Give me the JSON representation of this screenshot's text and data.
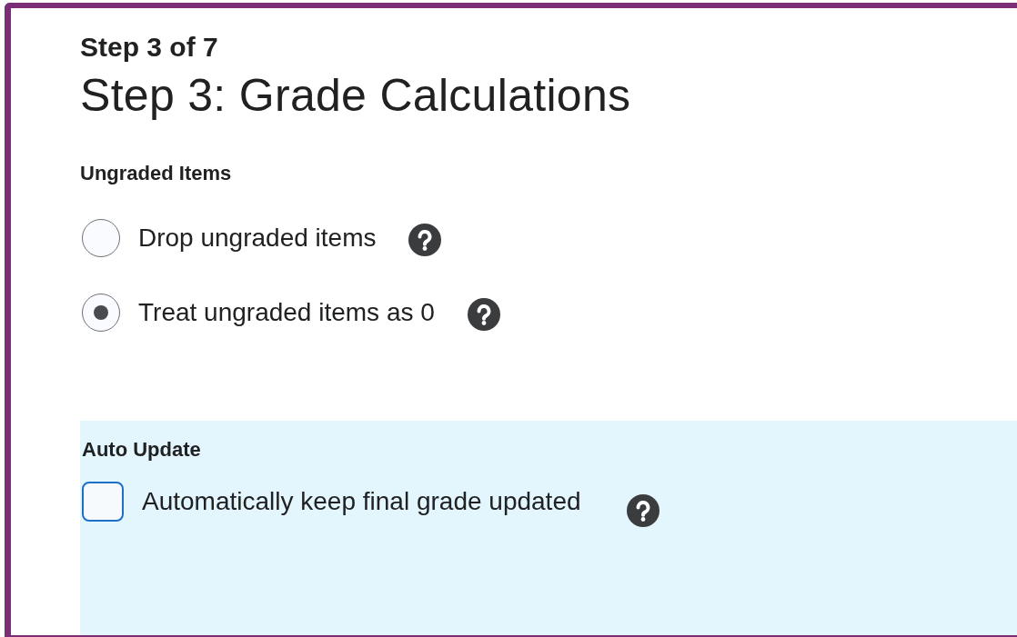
{
  "step_indicator": "Step 3 of 7",
  "title": "Step 3: Grade Calculations",
  "ungraded_items": {
    "heading": "Ungraded Items",
    "options": [
      {
        "label": "Drop ungraded items",
        "selected": false
      },
      {
        "label": "Treat ungraded items as 0",
        "selected": true
      }
    ]
  },
  "auto_update": {
    "heading": "Auto Update",
    "label": "Automatically keep final grade updated",
    "checked": false
  }
}
